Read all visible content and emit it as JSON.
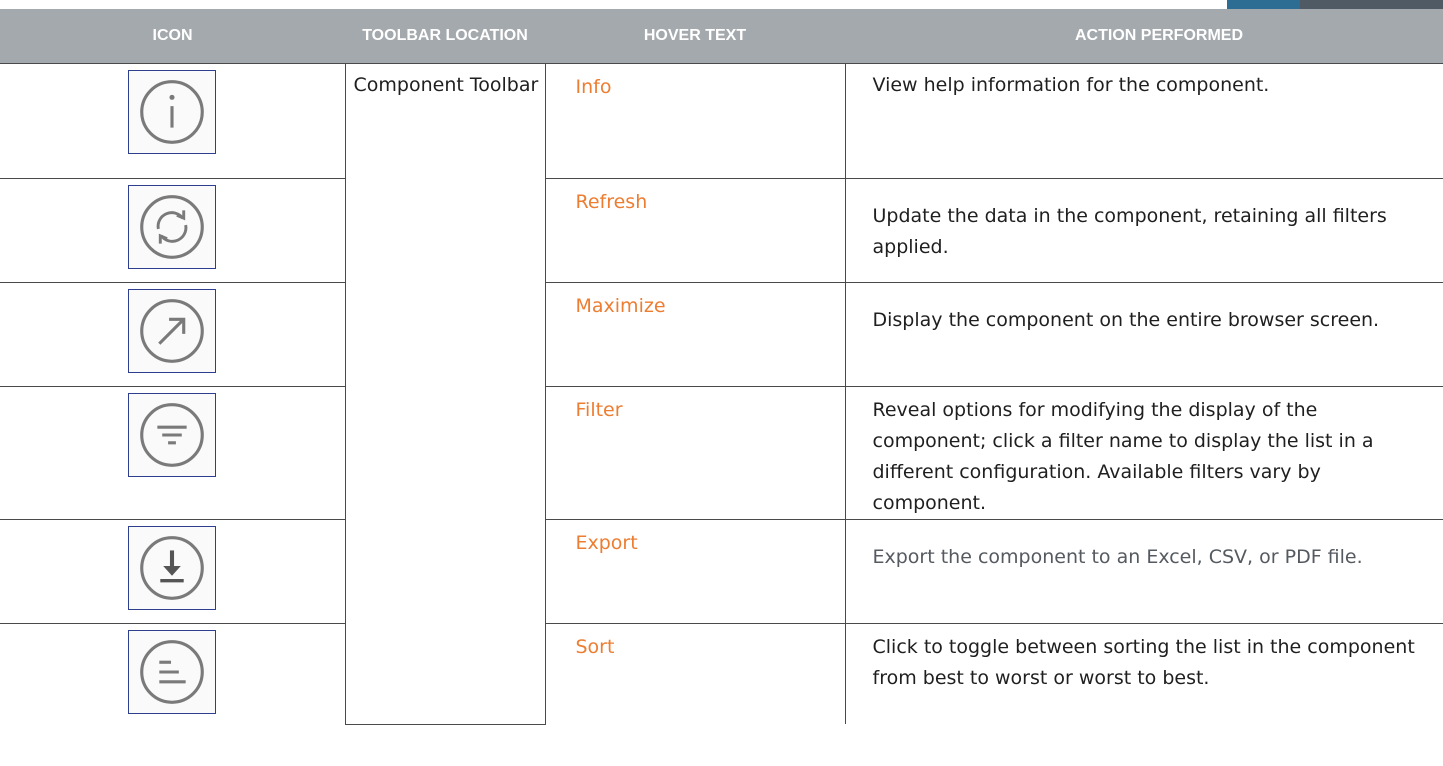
{
  "colors": {
    "header_bg": "#a4a9ad",
    "header_text": "#ffffff",
    "hover_text": "#ed7d31",
    "icon_border": "#2e3f8f",
    "icon_stroke": "#7a7a7a",
    "corner_blue": "#2d6c93",
    "corner_slate": "#4f5a64"
  },
  "headers": {
    "icon": "ICON",
    "toolbar_location": "TOOLBAR LOCATION",
    "hover_text": "HOVER TEXT",
    "action_performed": "ACTION PERFORMED"
  },
  "toolbar_location": "Component Toolbar",
  "rows": [
    {
      "icon": "info-icon",
      "hover": "Info",
      "action": "View help information for the component."
    },
    {
      "icon": "refresh-icon",
      "hover": "Refresh",
      "action": "Update the data in the component, retaining all filters applied."
    },
    {
      "icon": "maximize-icon",
      "hover": "Maximize",
      "action": "Display the component on the entire browser screen."
    },
    {
      "icon": "filter-icon",
      "hover": "Filter",
      "action": "Reveal options for modifying the display of the component; click a filter name to display the list in a different configuration. Available filters vary by component."
    },
    {
      "icon": "export-icon",
      "hover": "Export",
      "action": "Export the component to an Excel, CSV, or PDF file."
    },
    {
      "icon": "sort-icon",
      "hover": "Sort",
      "action": "Click to toggle between sorting the list in the component from best to worst or worst to best."
    }
  ]
}
